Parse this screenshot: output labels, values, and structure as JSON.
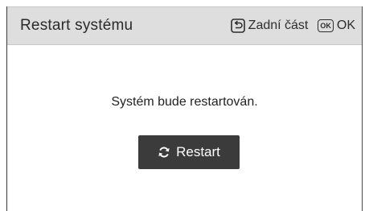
{
  "dialog": {
    "title": "Restart systému",
    "hints": {
      "back_icon": "back-icon",
      "back_label": "Zadní část",
      "ok_icon_text": "OK",
      "ok_label": "OK"
    },
    "message": "Systém bude restartován.",
    "restart_button": {
      "icon": "refresh-icon",
      "label": "Restart"
    }
  },
  "colors": {
    "header_background": "#dedede",
    "button_background": "#3b3b3b",
    "text": "#2a2a2a"
  }
}
